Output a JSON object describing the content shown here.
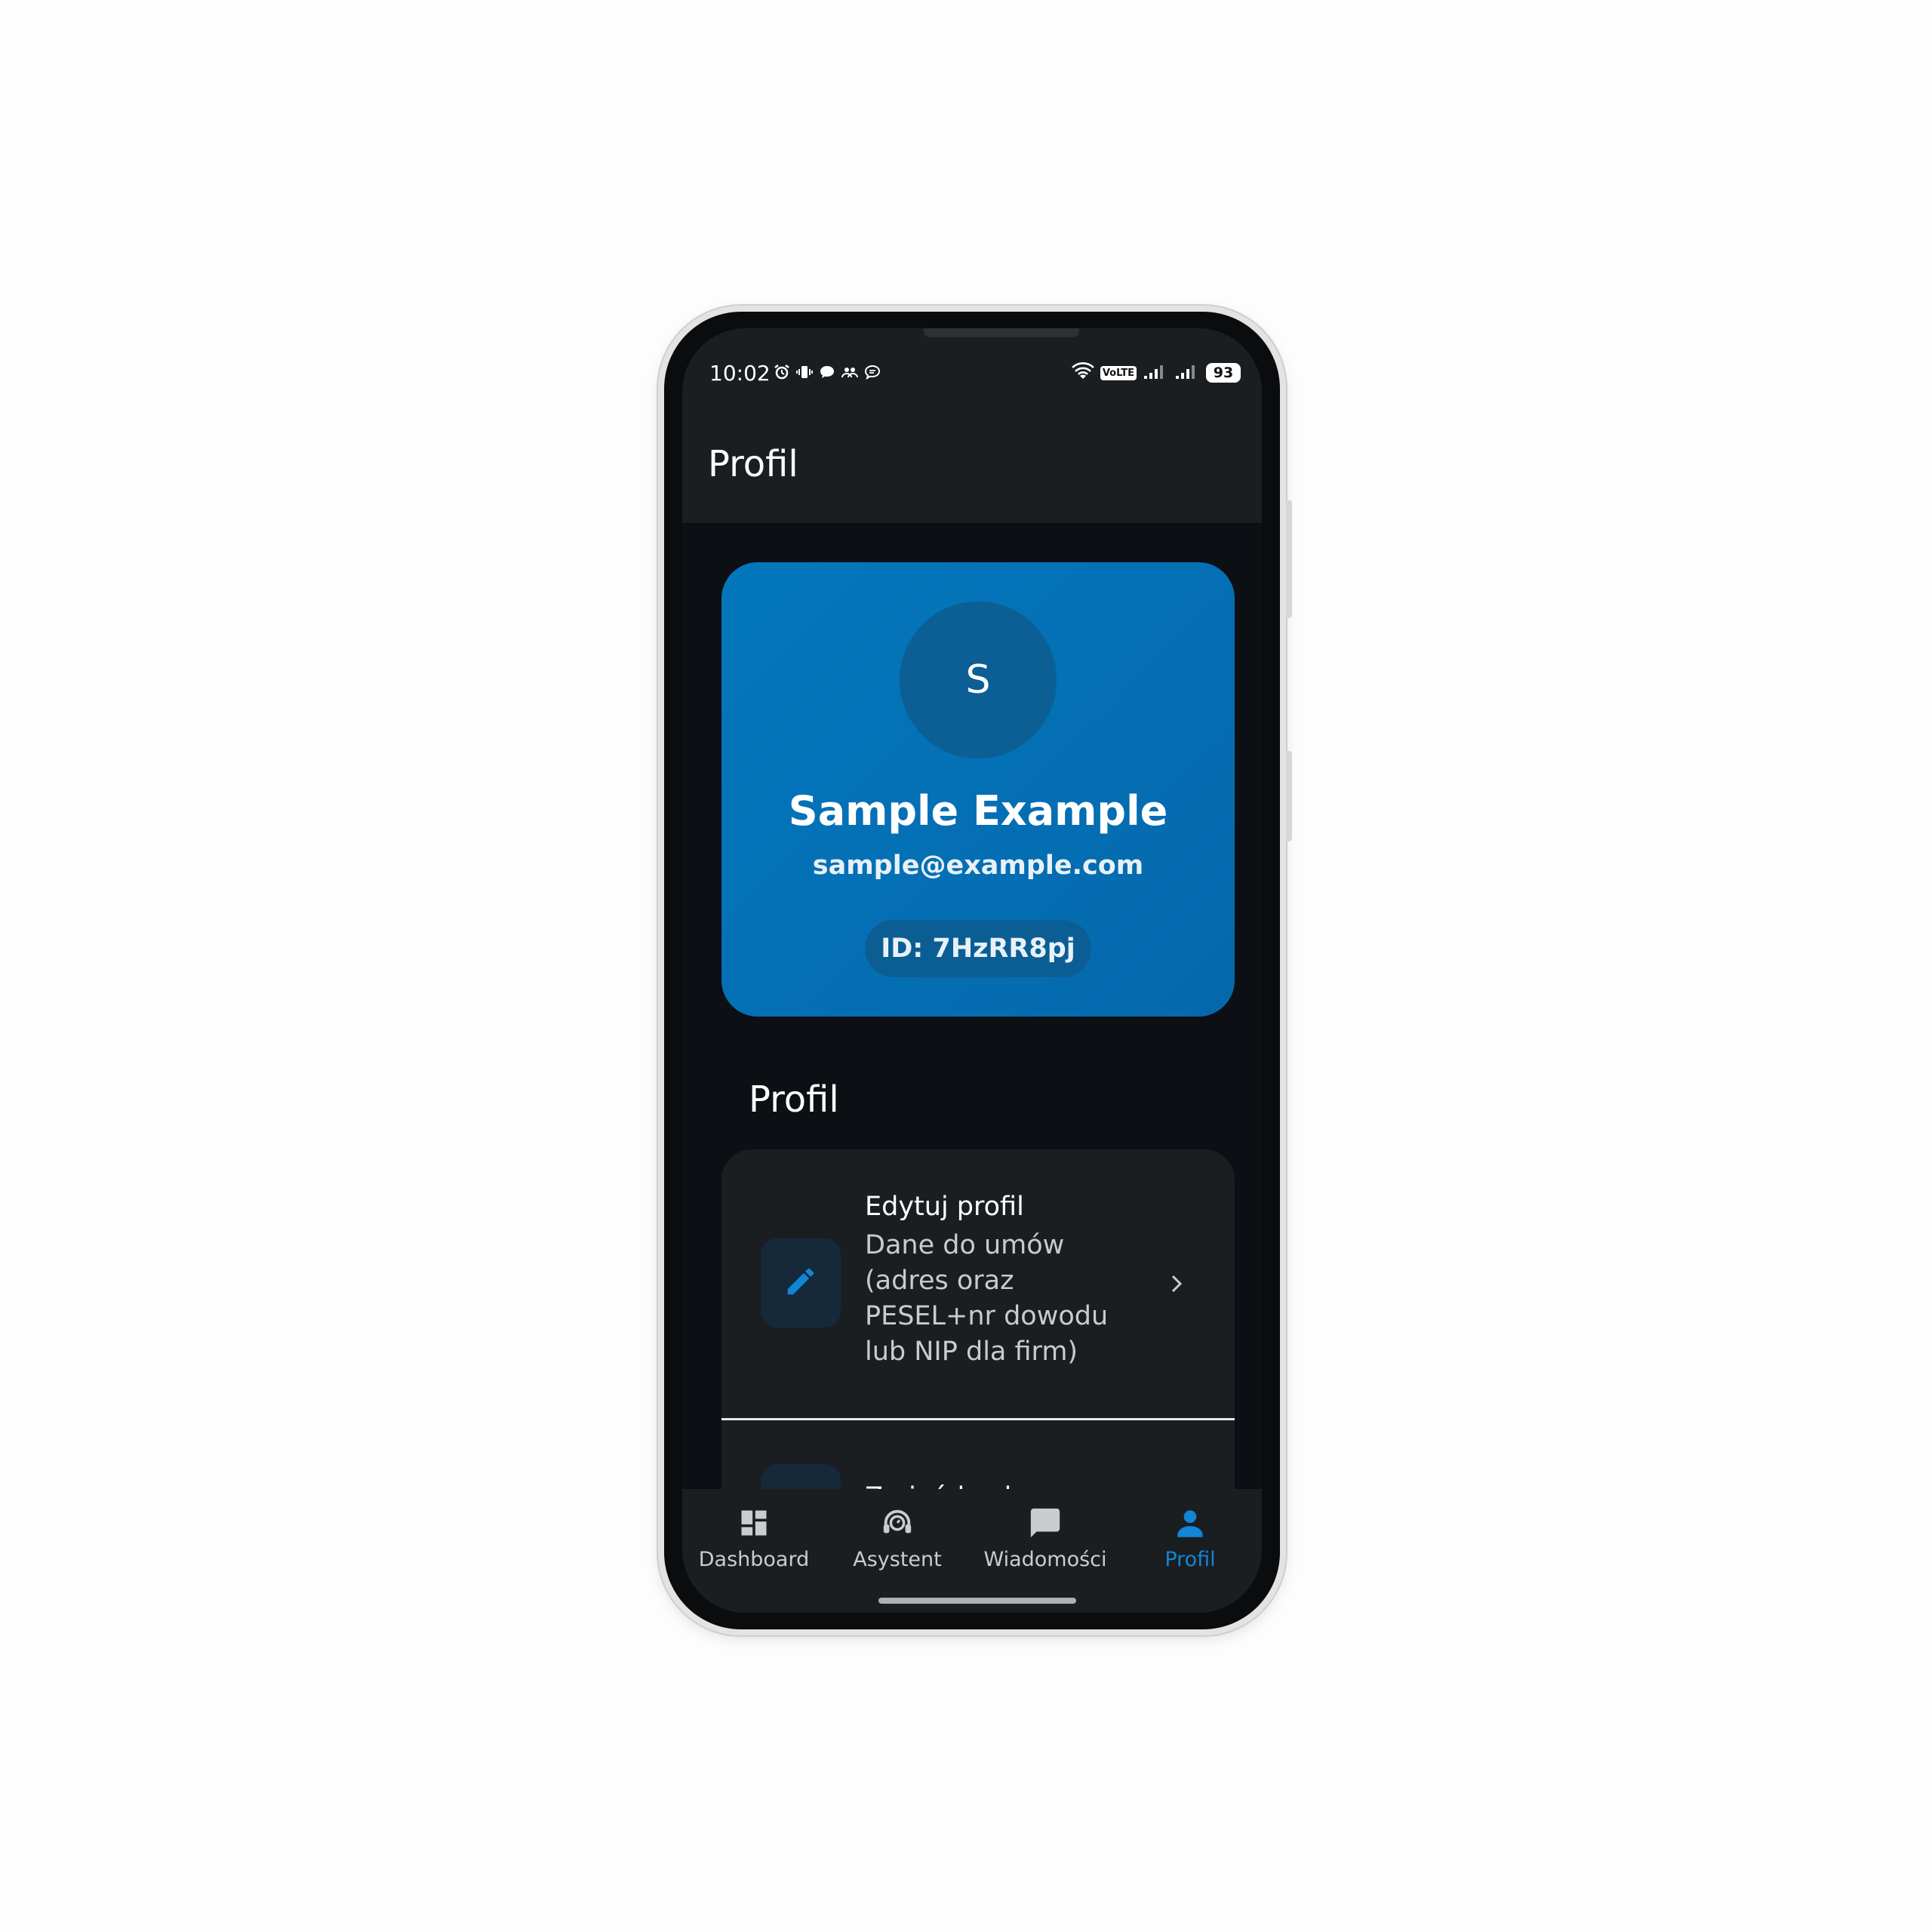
{
  "status_bar": {
    "time": "10:02",
    "volte": "VoLTE",
    "battery": "93"
  },
  "app_bar": {
    "title": "Profil"
  },
  "profile_card": {
    "avatar_initial": "S",
    "name": "Sample Example",
    "email": "sample@example.com",
    "id_label": "ID: 7HzRR8pj"
  },
  "section": {
    "title": "Profil"
  },
  "menu": {
    "items": [
      {
        "title": "Edytuj profil",
        "subtitle_lines": [
          "Dane do umów",
          "(adres oraz",
          "PESEL+nr dowodu",
          "lub NIP dla firm)"
        ],
        "icon": "pencil-icon"
      },
      {
        "title": "Zmień hasło",
        "icon": "lock-icon"
      }
    ]
  },
  "bottom_nav": {
    "items": [
      {
        "label": "Dashboard",
        "icon": "dashboard-icon"
      },
      {
        "label": "Asystent",
        "icon": "headset-icon"
      },
      {
        "label": "Wiadomości",
        "icon": "chat-icon"
      },
      {
        "label": "Profil",
        "icon": "person-icon",
        "active": true
      }
    ]
  },
  "colors": {
    "accent": "#1185d6",
    "card_gradient_start": "#0477bd",
    "card_gradient_end": "#0568ac",
    "background": "#0c0f13",
    "surface": "#1b1e21"
  }
}
